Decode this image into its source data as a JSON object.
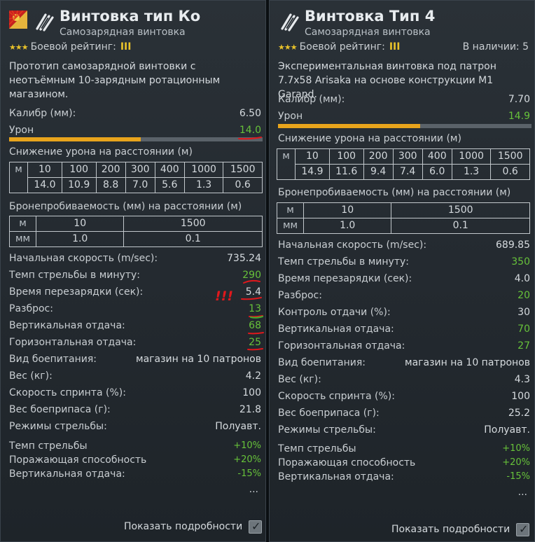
{
  "left": {
    "title": "Винтовка тип Ко",
    "subtitle": "Самозарядная винтовка",
    "rank_label": "Боевой рейтинг:",
    "rank_value": "III",
    "stars": "★★★",
    "description": "Прототип самозарядной винтовки с неотъёмным 10-зарядным ротационным магазином.",
    "caliber_label": "Калибр (мм):",
    "caliber_value": "6.50",
    "damage_label": "Урон",
    "damage_value": "14.0",
    "damage_fill_fraction": 0.52,
    "dropoff_title": "Снижение урона на расстоянии (м)",
    "dropoff_unit": "м",
    "dropoff_ranges": [
      "10",
      "100",
      "200",
      "300",
      "400",
      "1000",
      "1500"
    ],
    "dropoff_values": [
      "14.0",
      "10.9",
      "8.8",
      "7.0",
      "5.6",
      "1.3",
      "0.6"
    ],
    "pen_title": "Бронепробиваемость (мм) на расстоянии (м)",
    "pen_unit_top": "м",
    "pen_unit_bottom": "мм",
    "pen_ranges": [
      "10",
      "1500"
    ],
    "pen_values": [
      "1.0",
      "0.1"
    ],
    "stats": [
      {
        "label": "Начальная скорость (m/sec):",
        "value": "735.24",
        "green": false
      },
      {
        "label": "Темп стрельбы в минуту:",
        "value": "290",
        "green": true
      },
      {
        "label": "Время перезарядки (сек):",
        "value": "5.4",
        "green": false
      },
      {
        "label": "Разброс:",
        "value": "13",
        "green": true
      },
      {
        "label": "Вертикальная отдача:",
        "value": "68",
        "green": true
      },
      {
        "label": "Горизонтальная отдача:",
        "value": "25",
        "green": true
      },
      {
        "label": "Вид боепитания:",
        "value": "магазин на 10 патронов",
        "green": false
      },
      {
        "label": "Вес (кг):",
        "value": "4.2",
        "green": false
      },
      {
        "label": "Скорость спринта (%):",
        "value": "100",
        "green": false
      },
      {
        "label": "Вес боеприпаса (г):",
        "value": "21.8",
        "green": false
      },
      {
        "label": "Режимы стрельбы:",
        "value": "Полуавт.",
        "green": false
      }
    ],
    "mods": [
      {
        "label": "Темп стрельбы",
        "value": "+10%"
      },
      {
        "label": "Поражающая способность",
        "value": "+20%"
      },
      {
        "label": "Вертикальная отдача:",
        "value": "-15%"
      }
    ],
    "ellipsis": "...",
    "annotation_marks": "!!!",
    "details_label": "Показать подробности"
  },
  "right": {
    "title": "Винтовка Тип 4",
    "subtitle": "Самозарядная винтовка",
    "rank_label": "Боевой рейтинг:",
    "rank_value": "III",
    "stars": "★★★",
    "availability": "В наличии:  5",
    "description": "Экспериментальная винтовка под патрон 7.7x58 Arisaka на основе конструкции M1 Garand.",
    "caliber_label": "Калибр (мм):",
    "caliber_value": "7.70",
    "damage_label": "Урон",
    "damage_value": "14.9",
    "damage_fill_fraction": 0.56,
    "dropoff_title": "Снижение урона на расстоянии (м)",
    "dropoff_unit": "м",
    "dropoff_ranges": [
      "10",
      "100",
      "200",
      "300",
      "400",
      "1000",
      "1500"
    ],
    "dropoff_values": [
      "14.9",
      "11.6",
      "9.4",
      "7.4",
      "6.0",
      "1.3",
      "0.6"
    ],
    "pen_title": "Бронепробиваемость (мм) на расстоянии (м)",
    "pen_unit_top": "м",
    "pen_unit_bottom": "мм",
    "pen_ranges": [
      "10",
      "1500"
    ],
    "pen_values": [
      "1.0",
      "0.1"
    ],
    "stats": [
      {
        "label": "Начальная скорость (m/sec):",
        "value": "689.85",
        "green": false
      },
      {
        "label": "Темп стрельбы в минуту:",
        "value": "350",
        "green": true
      },
      {
        "label": "Время перезарядки (сек):",
        "value": "4.0",
        "green": false
      },
      {
        "label": "Разброс:",
        "value": "20",
        "green": true
      },
      {
        "label": "Контроль отдачи (%):",
        "value": "30",
        "green": false
      },
      {
        "label": "Вертикальная отдача:",
        "value": "70",
        "green": true
      },
      {
        "label": "Горизонтальная отдача:",
        "value": "27",
        "green": true
      },
      {
        "label": "Вид боепитания:",
        "value": "магазин на 10 патронов",
        "green": false
      },
      {
        "label": "Вес (кг):",
        "value": "4.3",
        "green": false
      },
      {
        "label": "Скорость спринта (%):",
        "value": "100",
        "green": false
      },
      {
        "label": "Вес боеприпаса (г):",
        "value": "25.2",
        "green": false
      },
      {
        "label": "Режимы стрельбы:",
        "value": "Полуавт.",
        "green": false
      }
    ],
    "mods": [
      {
        "label": "Темп стрельбы",
        "value": "+10%"
      },
      {
        "label": "Поражающая способность",
        "value": "+20%"
      },
      {
        "label": "Вертикальная отдача:",
        "value": "-15%"
      }
    ],
    "ellipsis": "...",
    "details_label": "Показать подробности"
  },
  "colors": {
    "accent_orange": "#e8a41c",
    "stat_green": "#67c23a",
    "annotation_red": "#e0181c",
    "stars_gold": "#e8c22a"
  },
  "icons": [
    "japan-flag-icon",
    "rifle-ammo-icon",
    "checkmark-icon"
  ]
}
